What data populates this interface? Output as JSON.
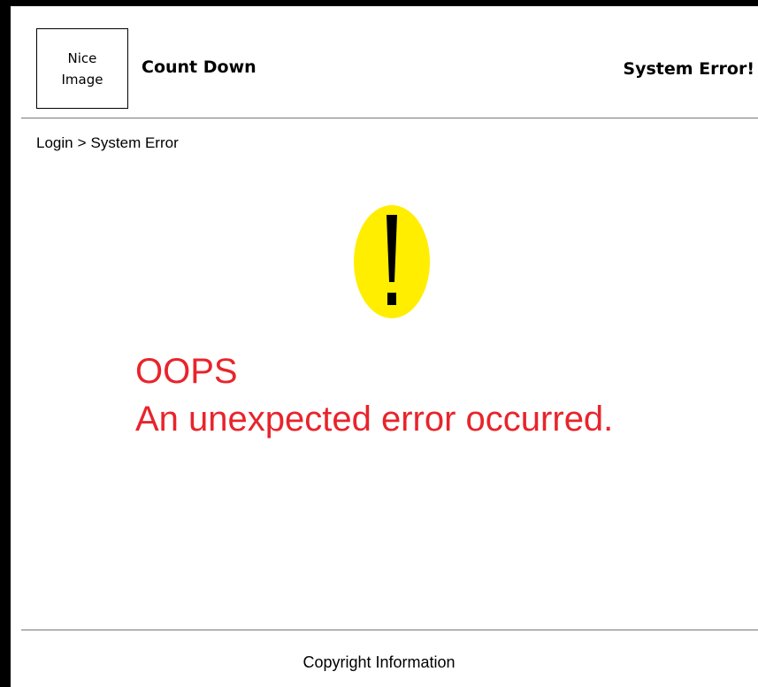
{
  "header": {
    "logo_lines": [
      "Nice",
      "Image"
    ],
    "app_title": "Count Down",
    "status": "System Error!"
  },
  "breadcrumb": {
    "items": [
      "Login",
      "System Error"
    ],
    "separator": ">"
  },
  "error": {
    "icon": "exclamation-warning-icon",
    "icon_color": "#ffee00",
    "heading": "OOPS",
    "message": "An unexpected error occurred.",
    "text_color": "#e8242b"
  },
  "footer": {
    "text": "Copyright Information"
  }
}
